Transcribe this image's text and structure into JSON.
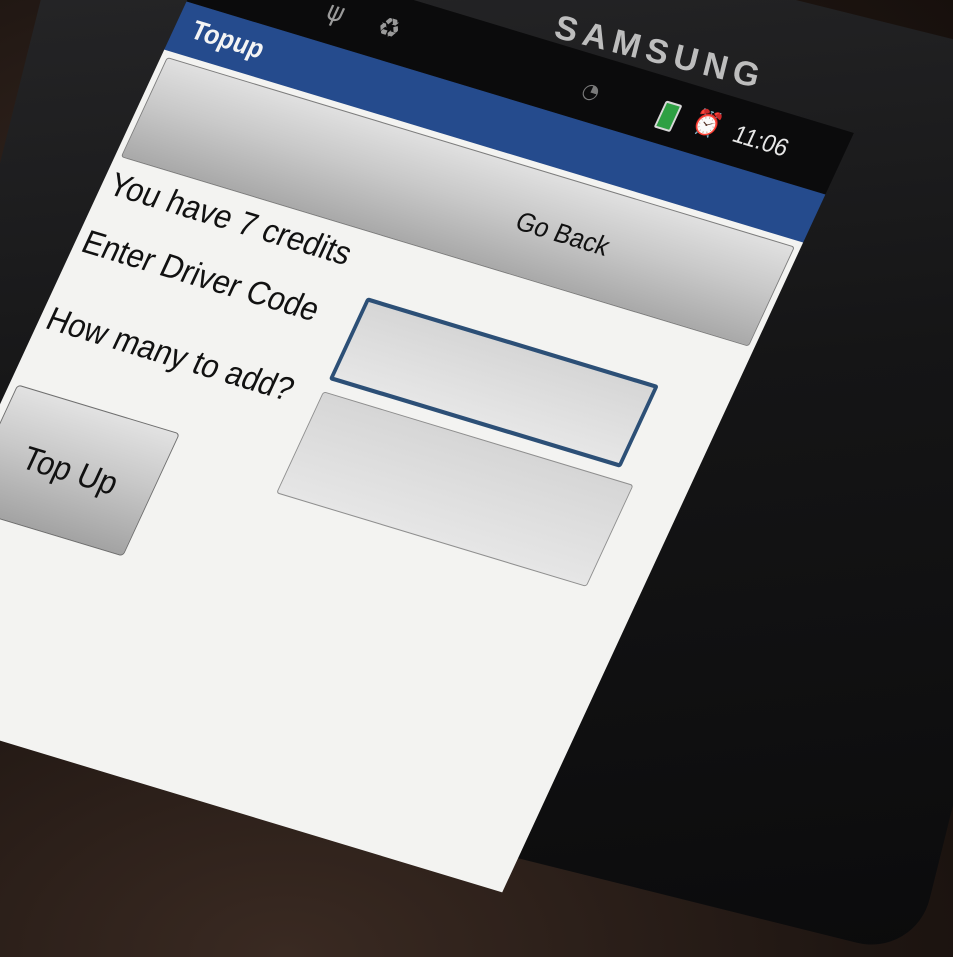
{
  "status_bar": {
    "brand": "SAMSUNG",
    "time": "11:06",
    "icons": [
      "notification-app-icon",
      "usb-icon",
      "recycle-icon",
      "wifi-icon",
      "battery-charging-icon",
      "alarm-icon"
    ]
  },
  "app": {
    "title": "Topup"
  },
  "buttons": {
    "go_back": "Go Back",
    "top_up": "Top Up"
  },
  "labels": {
    "credits": "You have 7 credits",
    "driver_code": "Enter Driver Code",
    "how_many": "How many to add?"
  },
  "fields": {
    "driver_code_value": "",
    "how_many_value": ""
  },
  "colors": {
    "title_bar": "#254b8d",
    "focused_field_border": "#2c4f76",
    "battery": "#2ea043"
  }
}
